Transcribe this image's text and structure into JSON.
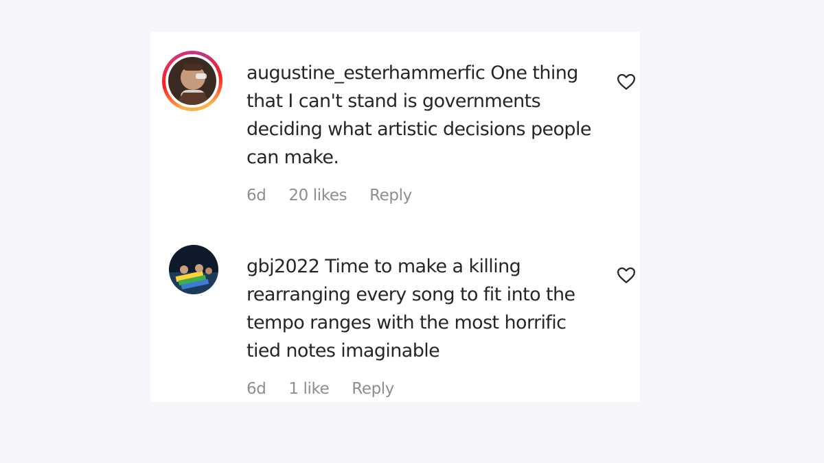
{
  "comments": [
    {
      "username": "augustine_esterhammerfic",
      "text": "One thing that I can't stand is governments deciding what artistic decisions people can make.",
      "age": "6d",
      "likes": "20 likes",
      "reply_label": "Reply",
      "has_story_ring": true
    },
    {
      "username": "gbj2022",
      "text": "Time to make a killing rearranging every song to fit into the tempo ranges with the most horrific tied notes imaginable",
      "age": "6d",
      "likes": "1 like",
      "reply_label": "Reply",
      "has_story_ring": false
    }
  ],
  "icons": {
    "like": "heart-outline-icon"
  },
  "colors": {
    "background": "#f4f6fa",
    "panel": "#ffffff",
    "text": "#262626",
    "meta": "#8e8e8e"
  }
}
